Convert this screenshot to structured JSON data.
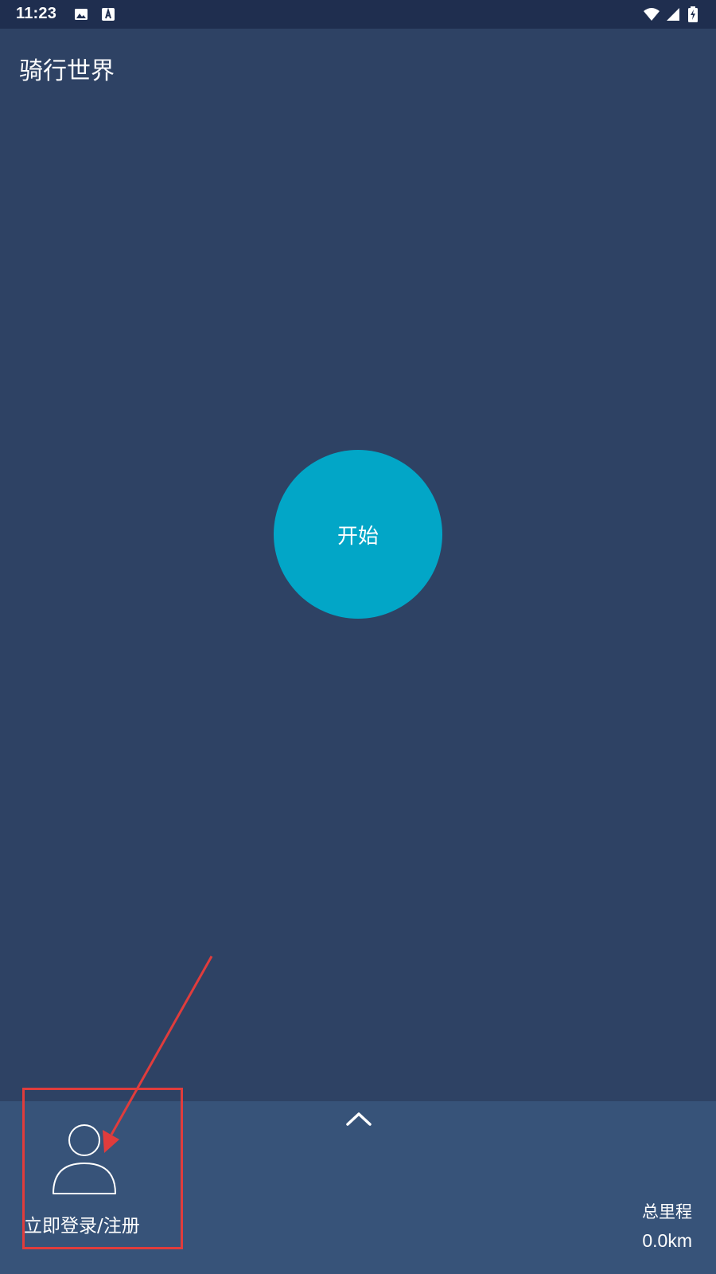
{
  "status_bar": {
    "time": "11:23",
    "icons": [
      "image-icon",
      "font-download-icon",
      "wifi-icon",
      "cell-signal-icon",
      "battery-charging-icon"
    ]
  },
  "header": {
    "title": "骑行世界"
  },
  "main": {
    "start_button_label": "开始"
  },
  "bottom_panel": {
    "login_label": "立即登录/注册",
    "mileage_label": "总里程",
    "mileage_value": "0.0km",
    "expand_icon": "chevron-up-icon",
    "avatar_icon": "user-icon"
  },
  "colors": {
    "background": "#2e4264",
    "status_bar": "#1f2e4f",
    "bottom_panel": "#375379",
    "start_button": "#02a6c7",
    "annotation": "#e03c3c"
  }
}
